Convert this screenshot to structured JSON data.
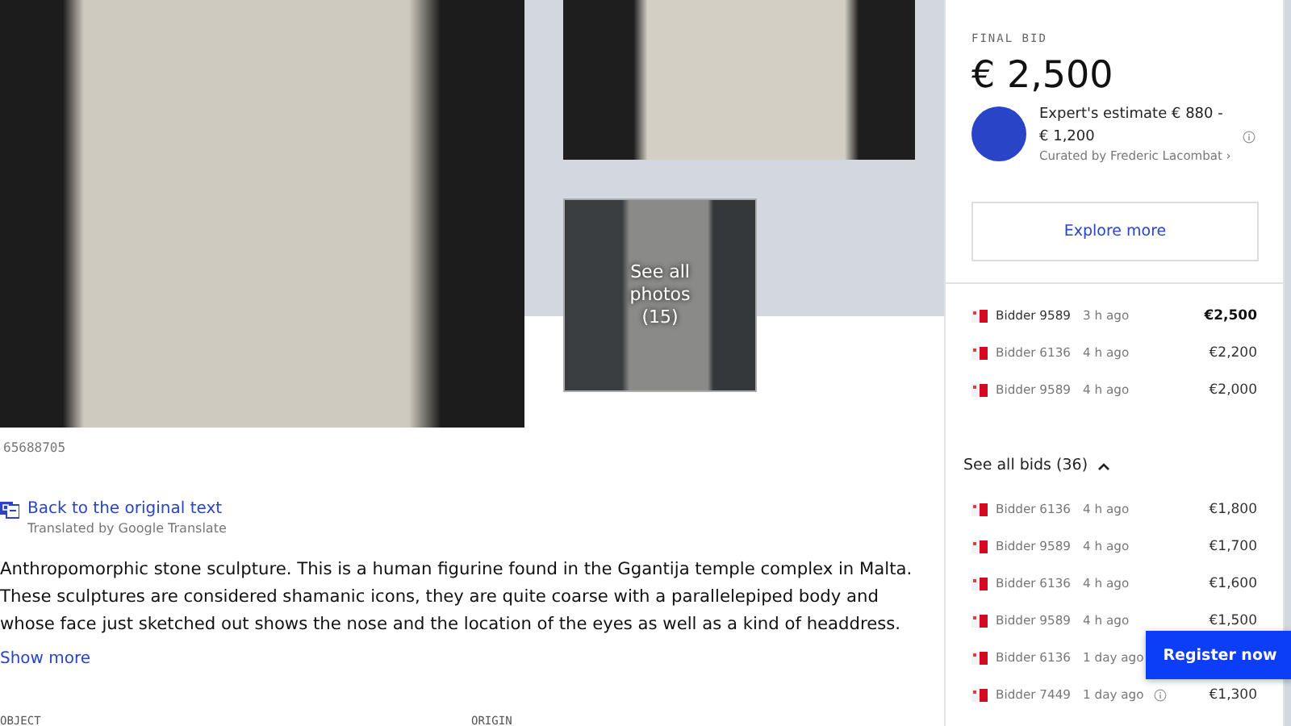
{
  "gallery": {
    "more_photos": "See all photos (15)"
  },
  "lot_number": "65688705",
  "translation": {
    "link": "Back to the original text",
    "note": "Translated by Google Translate"
  },
  "description": "Anthropomorphic stone sculpture. This is a human figurine found in the Ggantija temple complex in Malta. These sculptures are considered shamanic icons, they are quite coarse with a parallelepiped body and whose face just sketched out shows the nose and the location of the eyes as well as a kind of headdress.",
  "show_more": "Show more",
  "details": [
    {
      "label": "OBJECT"
    },
    {
      "label": "ORIGIN"
    }
  ],
  "bid_panel": {
    "label": "FINAL BID",
    "amount": "€ 2,500",
    "estimate": "Expert's estimate € 880 - € 1,200",
    "curator": "Curated by Frederic Lacombat ›",
    "explore": "Explore more"
  },
  "top_bids": [
    {
      "bidder": "Bidder 9589",
      "time": "3 h ago",
      "amount": "€2,500",
      "leading": true
    },
    {
      "bidder": "Bidder 6136",
      "time": "4 h ago",
      "amount": "€2,200",
      "leading": false
    },
    {
      "bidder": "Bidder 9589",
      "time": "4 h ago",
      "amount": "€2,000",
      "leading": false
    }
  ],
  "see_all_bids": {
    "label": "See all bids (36)",
    "expanded": true
  },
  "all_bids": [
    {
      "bidder": "Bidder 6136",
      "time": "4 h ago",
      "amount": "€1,800",
      "leading": false
    },
    {
      "bidder": "Bidder 9589",
      "time": "4 h ago",
      "amount": "€1,700",
      "leading": false
    },
    {
      "bidder": "Bidder 6136",
      "time": "4 h ago",
      "amount": "€1,600",
      "leading": false
    },
    {
      "bidder": "Bidder 9589",
      "time": "4 h ago",
      "amount": "€1,500",
      "leading": false
    },
    {
      "bidder": "Bidder 6136",
      "time": "1 day ago",
      "leading": false
    },
    {
      "bidder": "Bidder 7449",
      "time": "1 day ago",
      "amount": "€1,300",
      "leading": false,
      "info": true
    }
  ],
  "register": "Register now"
}
